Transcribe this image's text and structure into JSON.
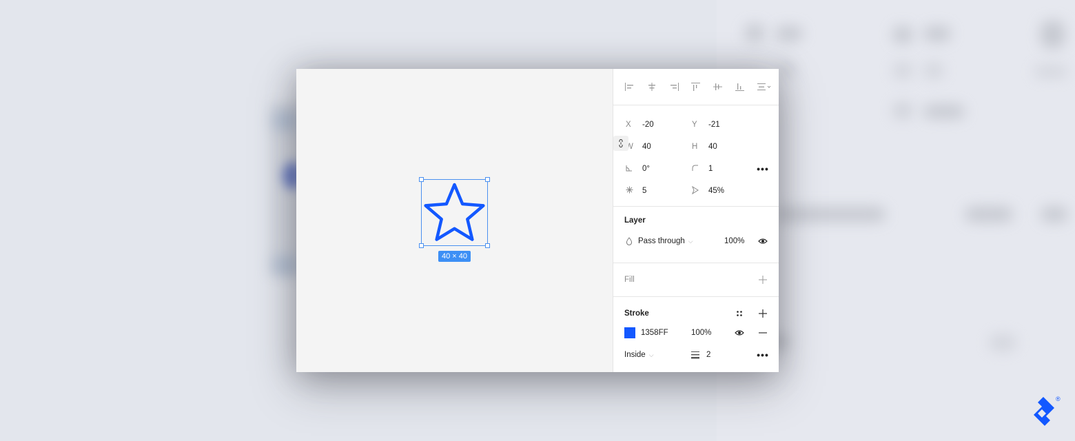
{
  "colors": {
    "accent": "#1358FF",
    "selection": "#4A90F0",
    "logo": "#1358FF"
  },
  "canvas": {
    "shape": "star",
    "size_badge": "40 × 40"
  },
  "alignment": {
    "icons": [
      "align-left-icon",
      "align-horizontal-center-icon",
      "align-right-icon",
      "align-top-icon",
      "align-vertical-center-icon",
      "align-bottom-icon",
      "distribute-menu-icon"
    ]
  },
  "properties": {
    "x": {
      "label": "X",
      "value": "-20"
    },
    "y": {
      "label": "Y",
      "value": "-21"
    },
    "w": {
      "label": "W",
      "value": "40"
    },
    "h": {
      "label": "H",
      "value": "40"
    },
    "rotation": {
      "value": "0°"
    },
    "corner_radius": {
      "value": "1"
    },
    "points": {
      "value": "5"
    },
    "ratio": {
      "value": "45%"
    }
  },
  "layer": {
    "title": "Layer",
    "blend_mode": "Pass through",
    "opacity": "100%"
  },
  "fill": {
    "title": "Fill"
  },
  "stroke": {
    "title": "Stroke",
    "color_hex": "1358FF",
    "opacity": "100%",
    "position": "Inside",
    "weight": "2"
  },
  "logo": {
    "registered": "®"
  }
}
